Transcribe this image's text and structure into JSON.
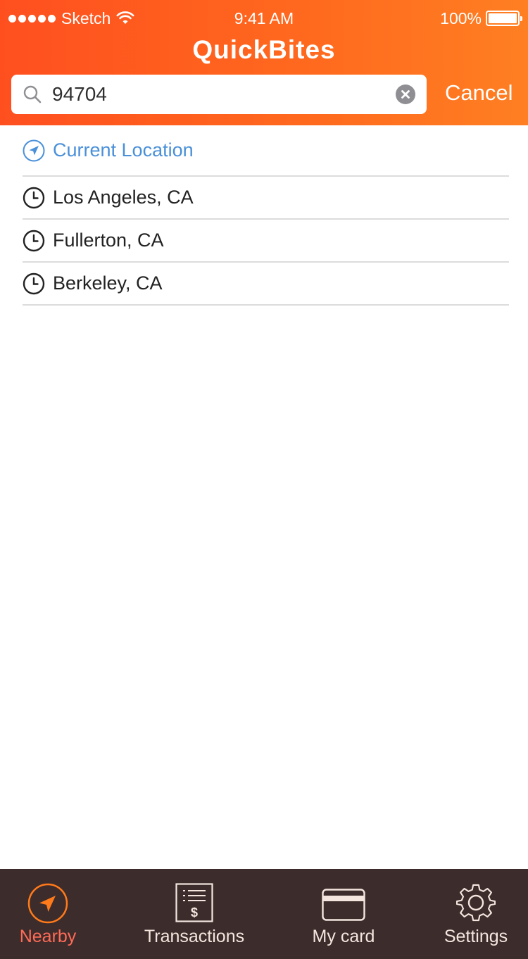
{
  "status_bar": {
    "carrier": "Sketch",
    "time": "9:41 AM",
    "battery": "100%"
  },
  "header": {
    "title": "QuickBites"
  },
  "search": {
    "value": "94704",
    "cancel_label": "Cancel"
  },
  "results": [
    {
      "label": "Current Location",
      "icon": "location-arrow-icon"
    },
    {
      "label": "Los Angeles, CA",
      "icon": "clock-icon"
    },
    {
      "label": "Fullerton, CA",
      "icon": "clock-icon"
    },
    {
      "label": "Berkeley, CA",
      "icon": "clock-icon"
    }
  ],
  "tabs": [
    {
      "label": "Nearby",
      "icon": "location-arrow-icon",
      "active": true
    },
    {
      "label": "Transactions",
      "icon": "receipt-icon",
      "active": false
    },
    {
      "label": "My card",
      "icon": "credit-card-icon",
      "active": false
    },
    {
      "label": "Settings",
      "icon": "gear-icon",
      "active": false
    }
  ],
  "colors": {
    "header_start": "#ff4f1f",
    "header_end": "#ff7f22",
    "current_location": "#4a90d9",
    "tab_bar": "#3c2c2b",
    "tab_active": "#ff6b57",
    "tab_icon_active": "#ff7a1a"
  }
}
